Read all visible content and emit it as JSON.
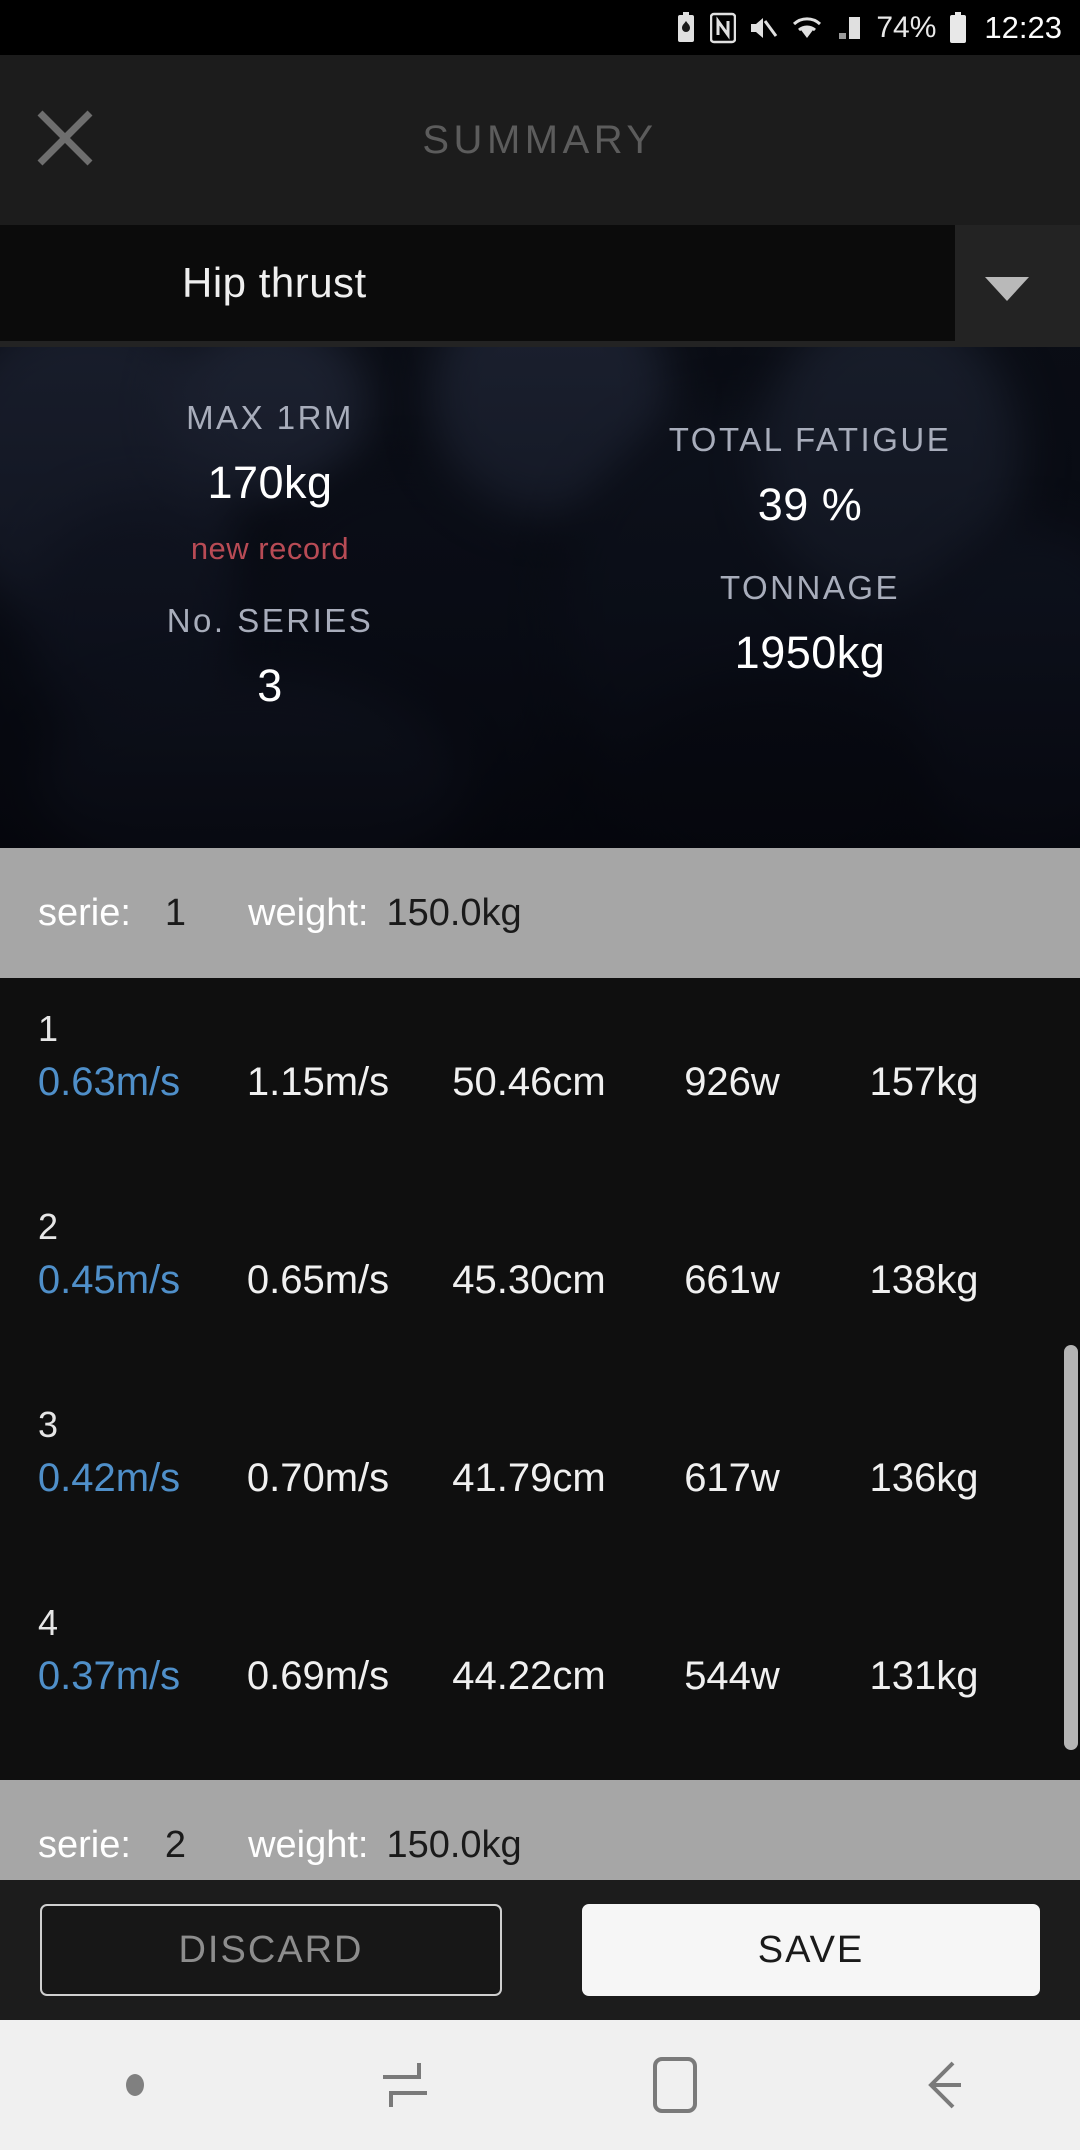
{
  "status_bar": {
    "battery_percent": "74%",
    "time": "12:23",
    "icons": [
      "battery-saver-icon",
      "nfc-icon",
      "mute-icon",
      "wifi-icon",
      "signal-icon",
      "battery-icon"
    ]
  },
  "header": {
    "title": "SUMMARY",
    "close_icon": "close-icon"
  },
  "exercise_selector": {
    "value": "Hip thrust",
    "caret_icon": "chevron-down-icon"
  },
  "summary": {
    "max_1rm": {
      "label": "MAX 1RM",
      "value": "170kg",
      "note": "new record"
    },
    "total_fatigue": {
      "label": "TOTAL FATIGUE",
      "value": "39 %"
    },
    "no_series": {
      "label": "No. SERIES",
      "value": "3"
    },
    "tonnage": {
      "label": "TONNAGE",
      "value": "1950kg"
    }
  },
  "series": [
    {
      "serie_key": "serie:",
      "serie_value": "1",
      "weight_key": "weight:",
      "weight_value": "150.0kg",
      "reps": [
        {
          "num": "1",
          "mean_velocity": "0.63m/s",
          "peak_velocity": "1.15m/s",
          "range": "50.46cm",
          "power": "926w",
          "load": "157kg"
        },
        {
          "num": "2",
          "mean_velocity": "0.45m/s",
          "peak_velocity": "0.65m/s",
          "range": "45.30cm",
          "power": "661w",
          "load": "138kg"
        },
        {
          "num": "3",
          "mean_velocity": "0.42m/s",
          "peak_velocity": "0.70m/s",
          "range": "41.79cm",
          "power": "617w",
          "load": "136kg"
        },
        {
          "num": "4",
          "mean_velocity": "0.37m/s",
          "peak_velocity": "0.69m/s",
          "range": "44.22cm",
          "power": "544w",
          "load": "131kg"
        }
      ]
    },
    {
      "serie_key": "serie:",
      "serie_value": "2",
      "weight_key": "weight:",
      "weight_value": "150.0kg",
      "reps": []
    }
  ],
  "actions": {
    "discard_label": "DISCARD",
    "save_label": "SAVE"
  },
  "nav_bar": {
    "items": [
      "dot-indicator-icon",
      "recents-icon",
      "home-icon",
      "back-icon"
    ]
  },
  "colors": {
    "accent_blue": "#4f8fc9",
    "record_red": "#b84b55",
    "bar_gray": "#a6a6a6",
    "save_white": "#f6f6f6"
  }
}
